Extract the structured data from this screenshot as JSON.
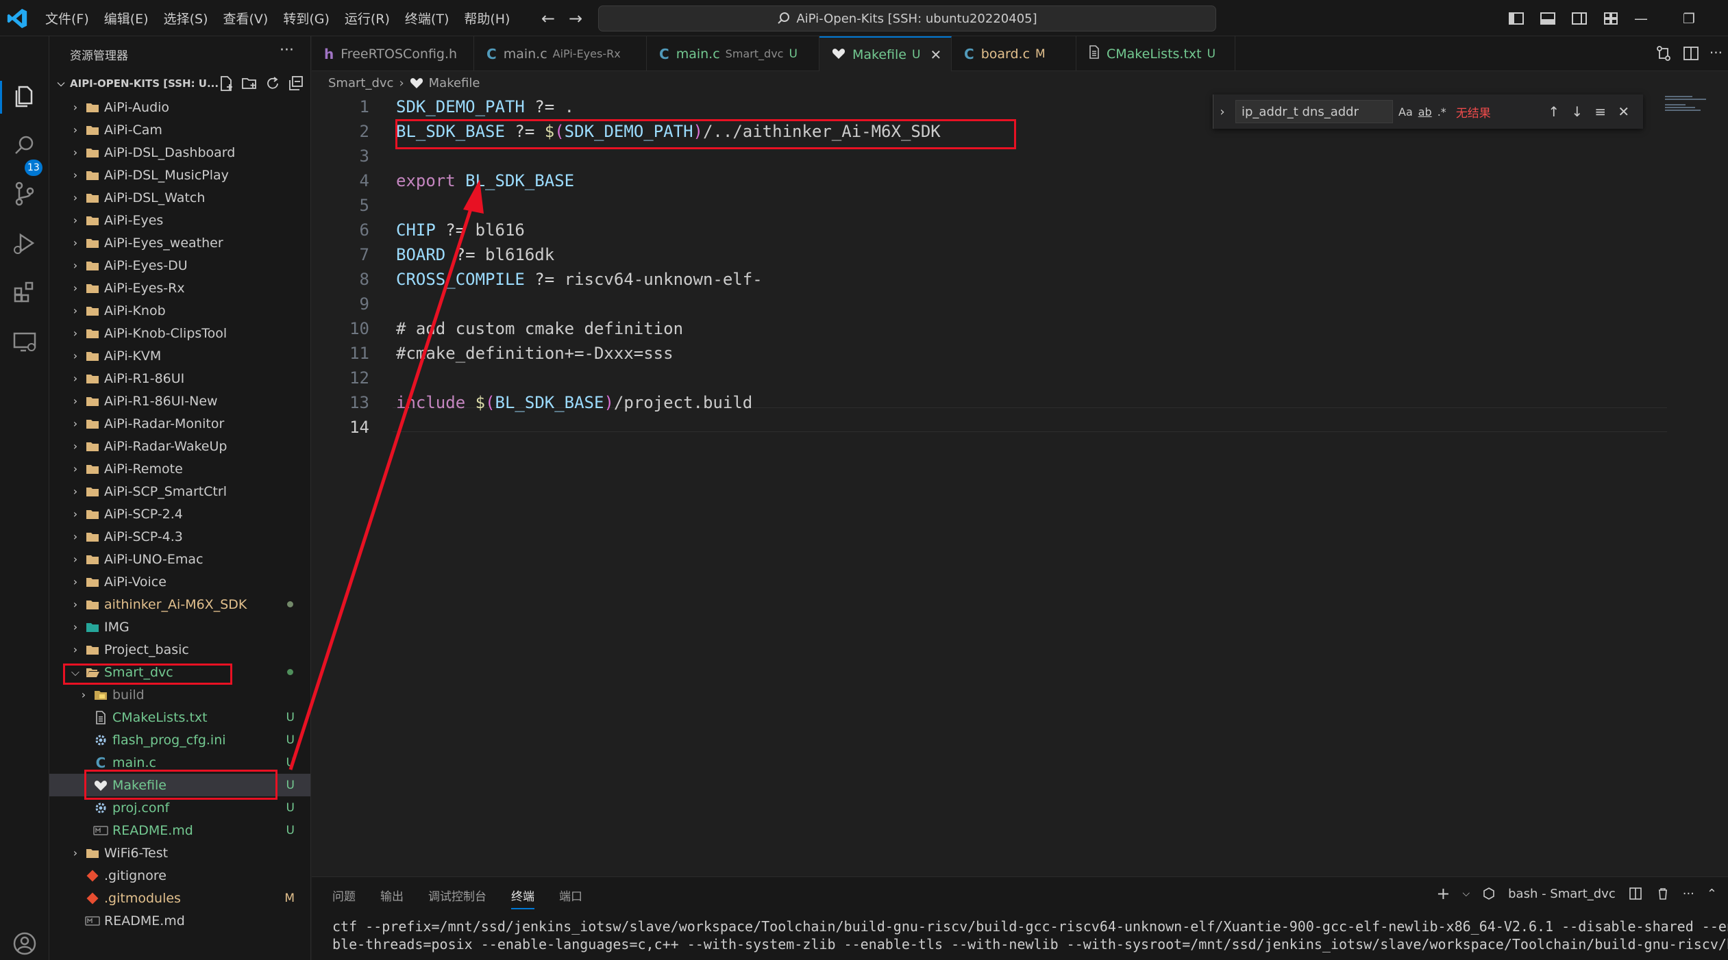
{
  "window": {
    "menu": [
      "文件(F)",
      "编辑(E)",
      "选择(S)",
      "查看(V)",
      "转到(G)",
      "运行(R)",
      "终端(T)",
      "帮助(H)"
    ],
    "command_center": "AiPi-Open-Kits [SSH: ubuntu20220405]"
  },
  "activity": {
    "scm_badge": "13"
  },
  "explorer": {
    "title": "资源管理器",
    "more": "···",
    "root_label": "AIPI-OPEN-KITS [SSH: U...",
    "folders": [
      "AiPi-Audio",
      "AiPi-Cam",
      "AiPi-DSL_Dashboard",
      "AiPi-DSL_MusicPlay",
      "AiPi-DSL_Watch",
      "AiPi-Eyes",
      "AiPi-Eyes_weather",
      "AiPi-Eyes-DU",
      "AiPi-Eyes-Rx",
      "AiPi-Knob",
      "AiPi-Knob-ClipsTool",
      "AiPi-KVM",
      "AiPi-R1-86UI",
      "AiPi-R1-86UI-New",
      "AiPi-Radar-Monitor",
      "AiPi-Radar-WakeUp",
      "AiPi-Remote",
      "AiPi-SCP_SmartCtrl",
      "AiPi-SCP-2.4",
      "AiPi-SCP-4.3",
      "AiPi-UNO-Emac",
      "AiPi-Voice"
    ],
    "sdk_folder": "aithinker_Ai-M6X_SDK",
    "img_folder": "IMG",
    "project_basic": "Project_basic",
    "smart_dvc": "Smart_dvc",
    "smart_children": [
      {
        "label": "build",
        "badge": ""
      },
      {
        "label": "CMakeLists.txt",
        "badge": "U"
      },
      {
        "label": "flash_prog_cfg.ini",
        "badge": "U"
      },
      {
        "label": "main.c",
        "badge": "U"
      },
      {
        "label": "Makefile",
        "badge": "U"
      },
      {
        "label": "proj.conf",
        "badge": "U"
      },
      {
        "label": "README.md",
        "badge": "U"
      }
    ],
    "wifi_folder": "WiFi6-Test",
    "root_files": [
      {
        "label": ".gitignore",
        "badge": ""
      },
      {
        "label": ".gitmodules",
        "badge": "M"
      },
      {
        "label": "README.md",
        "badge": ""
      }
    ]
  },
  "tabs": [
    {
      "icon": "h",
      "label": "FreeRTOSConfig.h",
      "desc": "",
      "badge": ""
    },
    {
      "icon": "C",
      "label": "main.c",
      "desc": "AiPi-Eyes-Rx",
      "badge": ""
    },
    {
      "icon": "C",
      "label": "main.c",
      "desc": "Smart_dvc",
      "badge": "U"
    },
    {
      "icon": "",
      "label": "Makefile",
      "desc": "",
      "badge": "U",
      "close": "✕"
    },
    {
      "icon": "C",
      "label": "board.c",
      "desc": "",
      "badge": "M"
    },
    {
      "icon": "",
      "label": "CMakeLists.txt",
      "desc": "",
      "badge": "U"
    }
  ],
  "breadcrumb": [
    "Smart_dvc",
    "Makefile"
  ],
  "editor": {
    "line_numbers": [
      "1",
      "2",
      "3",
      "4",
      "5",
      "6",
      "7",
      "8",
      "9",
      "10",
      "11",
      "12",
      "13",
      "14"
    ]
  },
  "find": {
    "query": "ip_addr_t dns_addr",
    "opt_case": "Aa",
    "opt_word": "ab",
    "opt_regex": ".*",
    "result": "无结果"
  },
  "panel": {
    "tabs": [
      "问题",
      "输出",
      "调试控制台",
      "终端",
      "端口"
    ],
    "terminal_name": "bash - Smart_dvc",
    "terminal_lines": [
      "ctf --prefix=/mnt/ssd/jenkins_iotsw/slave/workspace/Toolchain/build-gnu-riscv/build-gcc-riscv64-unknown-elf/Xuantie-900-gcc-elf-newlib-x86_64-V2.6.1 --disable-shared --enable",
      "ble-threads=posix --enable-languages=c,c++ --with-system-zlib --enable-tls --with-newlib --with-sysroot=/mnt/ssd/jenkins_iotsw/slave/workspace/Toolchain/build-gnu-riscv/b"
    ]
  },
  "colors": {
    "accent": "#0078d4",
    "annotation": "#e81123",
    "untracked": "#73c991",
    "modified": "#e2c08d"
  }
}
